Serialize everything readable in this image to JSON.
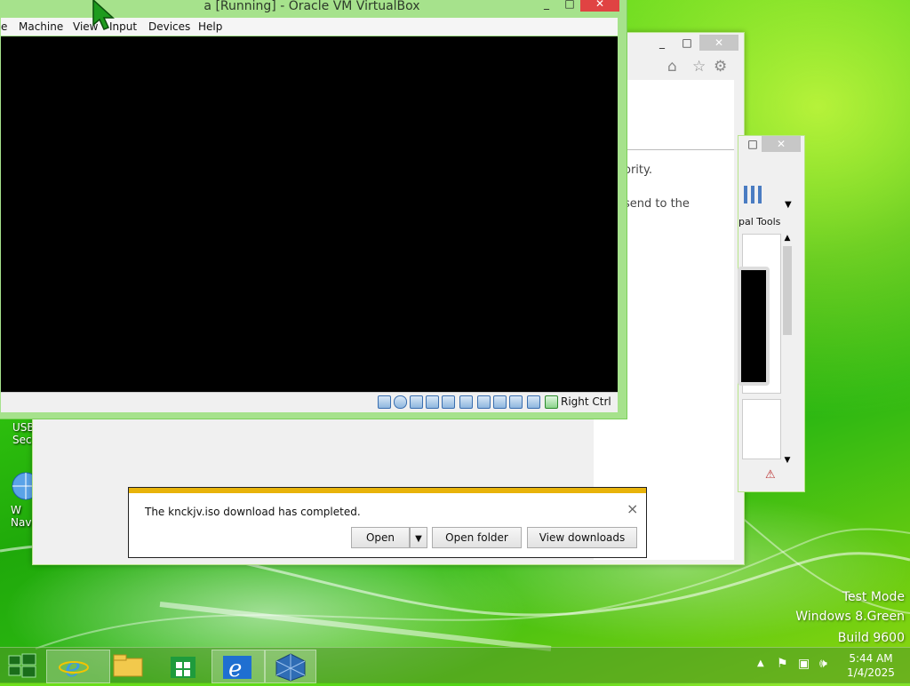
{
  "desktop": {
    "icons": [
      {
        "label": "USB\nSec"
      },
      {
        "label": "W\nNavi"
      }
    ],
    "watermark": {
      "line1": "Test Mode",
      "line2": "Windows 8.Green",
      "line3": "Build 9600"
    }
  },
  "ie_window": {
    "text_fragments": [
      "ority.",
      "send to the"
    ],
    "icons": [
      "home-icon",
      "star-icon",
      "gear-icon"
    ]
  },
  "vm_manager": {
    "tools_label": "pal Tools"
  },
  "vbox": {
    "title": "a [Running] - Oracle VM VirtualBox",
    "menu": [
      "e",
      "Machine",
      "View",
      "Input",
      "Devices",
      "Help"
    ],
    "host_key": "Right Ctrl"
  },
  "download_bar": {
    "message": "The knckjv.iso download has completed.",
    "open_label": "Open",
    "open_folder_label": "Open folder",
    "view_downloads_label": "View downloads",
    "close_glyph": "×"
  },
  "taskbar": {
    "time": "5:44 AM",
    "date": "1/4/2025",
    "apps": [
      "internet-explorer",
      "file-explorer",
      "store",
      "internet-explorer-2",
      "virtualbox"
    ]
  },
  "colors": {
    "accent_green": "#33c80f",
    "download_bar_stripe": "#e8b30a",
    "close_button": "#c7c7c7"
  }
}
